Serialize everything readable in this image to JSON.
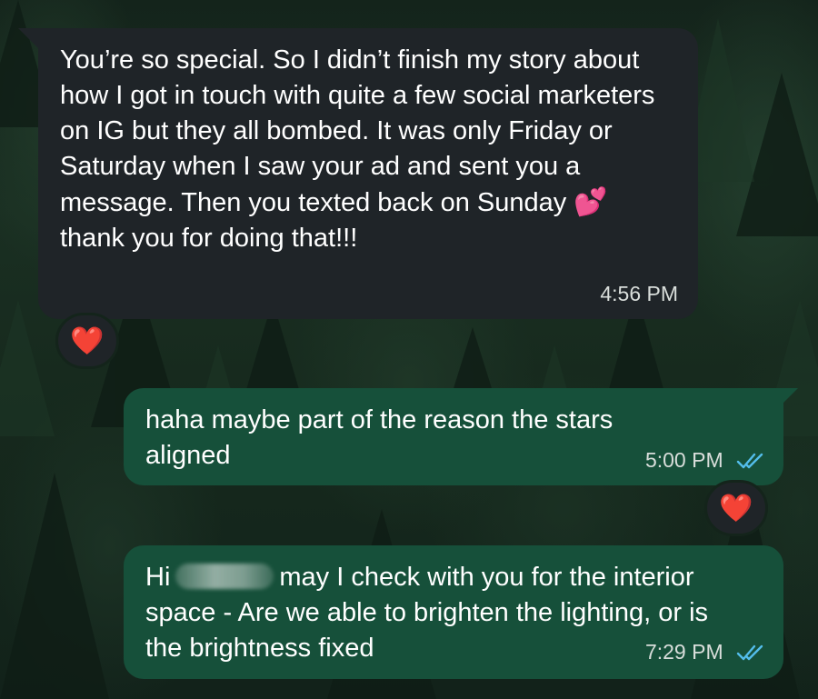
{
  "messages": [
    {
      "direction": "incoming",
      "text_part1": "You’re so special. So I didn’t finish my story about how I got in touch with quite a few social marketers on IG but they all bombed. It was only Friday or Saturday when I saw your ad and sent you a message. Then you texted back on Sunday",
      "emoji": "💕",
      "text_part2": "thank you for doing that!!!",
      "time": "4:56 PM",
      "reaction": "❤️"
    },
    {
      "direction": "outgoing",
      "text": "haha maybe part of the reason the stars aligned",
      "time": "5:00 PM",
      "status": "read",
      "reaction": "❤️"
    },
    {
      "direction": "outgoing",
      "greeting": "Hi",
      "text": "may I check with you for the interior space - Are we able to brighten the lighting, or is the brightness fixed",
      "time": "7:29 PM",
      "status": "read"
    }
  ],
  "colors": {
    "incoming_bubble": "#1f2428",
    "outgoing_bubble": "#16503a",
    "read_ticks": "#53bdeb",
    "heart": "#e8283c"
  }
}
